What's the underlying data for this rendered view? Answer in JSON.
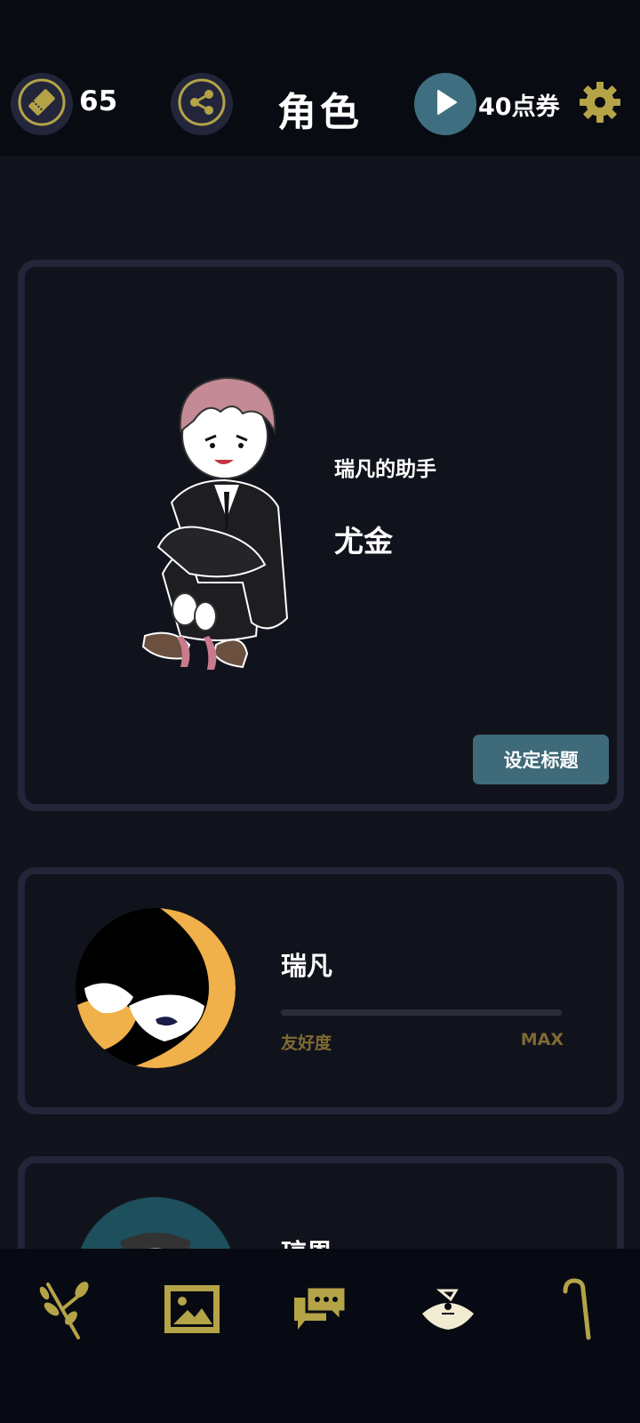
{
  "header": {
    "ticket_count": "65",
    "title": "角色",
    "points_label": "40点券",
    "ticket_icon": "ticket-icon",
    "share_icon": "share-icon",
    "play_icon": "play-icon",
    "settings_icon": "gear-icon"
  },
  "hero": {
    "subtitle": "瑞凡的助手",
    "name": "尤金",
    "set_title_button": "设定标题"
  },
  "characters": [
    {
      "name": "瑞凡",
      "affinity_label": "友好度",
      "affinity_value": "MAX"
    },
    {
      "name": "琼恩"
    }
  ],
  "nav": [
    {
      "icon": "branch-icon"
    },
    {
      "icon": "gallery-icon"
    },
    {
      "icon": "chat-icon"
    },
    {
      "icon": "character-icon",
      "active": true
    },
    {
      "icon": "cane-icon"
    }
  ],
  "colors": {
    "background": "#12141d",
    "topbar": "#090b12",
    "accent_gold": "#b4a347",
    "accent_teal": "#3e6f80",
    "card_border": "#232538"
  }
}
